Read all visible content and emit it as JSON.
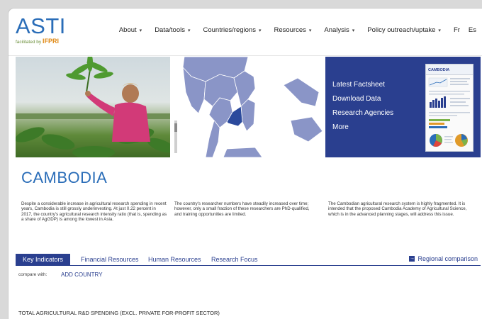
{
  "header": {
    "logo_main": "ASTI",
    "logo_sub_prefix": "facilitated by",
    "logo_sub_brand": "IFPRI",
    "nav": [
      {
        "label": "About",
        "caret": "▾"
      },
      {
        "label": "Data/tools",
        "caret": "▾"
      },
      {
        "label": "Countries/regions",
        "caret": "▾"
      },
      {
        "label": "Resources",
        "caret": "▾"
      },
      {
        "label": "Analysis",
        "caret": "▾"
      },
      {
        "label": "Policy outreach/uptake",
        "caret": "▾"
      },
      {
        "label": "Fr",
        "caret": ""
      },
      {
        "label": "Es",
        "caret": ""
      }
    ]
  },
  "banner": {
    "links": [
      "Latest Factsheet",
      "Download Data",
      "Research Agencies",
      "More"
    ],
    "factsheet_title": "CAMBODIA"
  },
  "country": {
    "title": "CAMBODIA",
    "descriptions": [
      "Despite a considerable increase in agricultural research spending in recent years, Cambodia is still grossly underinvesting. At just 0.22 percent in 2017, the country's agricultural research intensity ratio (that is, spending as a share of AgGDP) is among the lowest in Asia.",
      "The country's researcher numbers have steadily increased over time; however, only a small fraction of these researchers are PhD-qualified, and training opportunities are limited.",
      "The Cambodian agricultural research system is highly fragmented. It is intended that the proposed Cambodia Academy of Agricultural Science, which is in the advanced planning stages, will address this issue."
    ]
  },
  "tabs": {
    "items": [
      "Key Indicators",
      "Financial Resources",
      "Human Resources",
      "Research Focus"
    ],
    "regional_icon": "→",
    "regional": "Regional comparison"
  },
  "compare": {
    "label": "compare with:",
    "add_country": "ADD COUNTRY"
  },
  "section_title": "TOTAL AGRICULTURAL R&D SPENDING (EXCL. PRIVATE FOR-PROFIT SECTOR)",
  "colors": {
    "brand_blue": "#2a6db8",
    "panel_navy": "#2a3f8f",
    "map_land": "#8a95c7",
    "map_highlight": "#2b4a9c"
  }
}
